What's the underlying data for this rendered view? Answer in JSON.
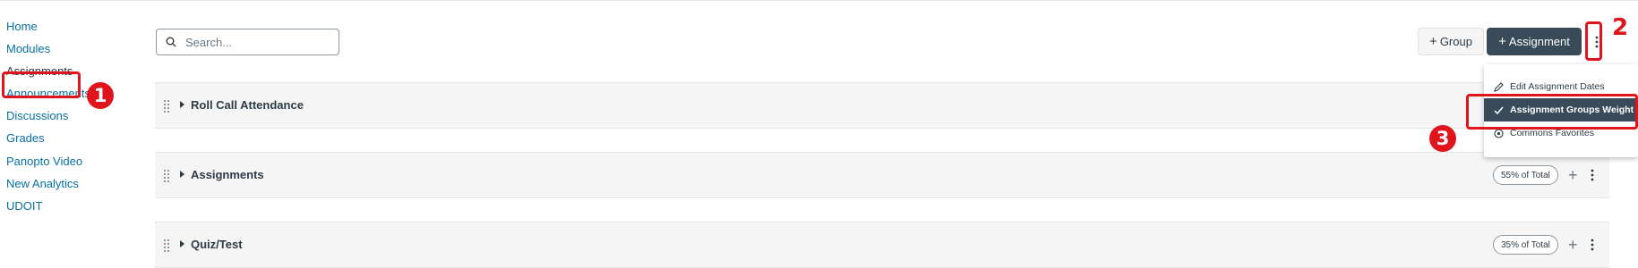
{
  "sidebar": {
    "items": [
      {
        "label": "Home"
      },
      {
        "label": "Modules"
      },
      {
        "label": "Assignments"
      },
      {
        "label": "Announcements"
      },
      {
        "label": "Discussions"
      },
      {
        "label": "Grades"
      },
      {
        "label": "Panopto Video"
      },
      {
        "label": "New Analytics"
      },
      {
        "label": "UDOIT"
      }
    ]
  },
  "search": {
    "placeholder": "Search..."
  },
  "toolbar": {
    "group_label": "Group",
    "assignment_label": "Assignment"
  },
  "groups": [
    {
      "title": "Roll Call Attendance",
      "weight": ""
    },
    {
      "title": "Assignments",
      "weight": "55% of Total"
    },
    {
      "title": "Quiz/Test",
      "weight": "35% of Total"
    }
  ],
  "menu": {
    "items": [
      {
        "label": "Edit Assignment Dates",
        "icon": "pencil-icon"
      },
      {
        "label": "Assignment Groups Weight",
        "icon": "checkmark-icon",
        "selected": true
      },
      {
        "label": "Commons Favorites",
        "icon": "commons-icon"
      }
    ]
  },
  "annotations": {
    "badge1": "1",
    "badge2": "2",
    "badge3": "3"
  },
  "colors": {
    "annotation": "#e0151c",
    "link": "#0770a3",
    "dark_button": "#394b58"
  }
}
